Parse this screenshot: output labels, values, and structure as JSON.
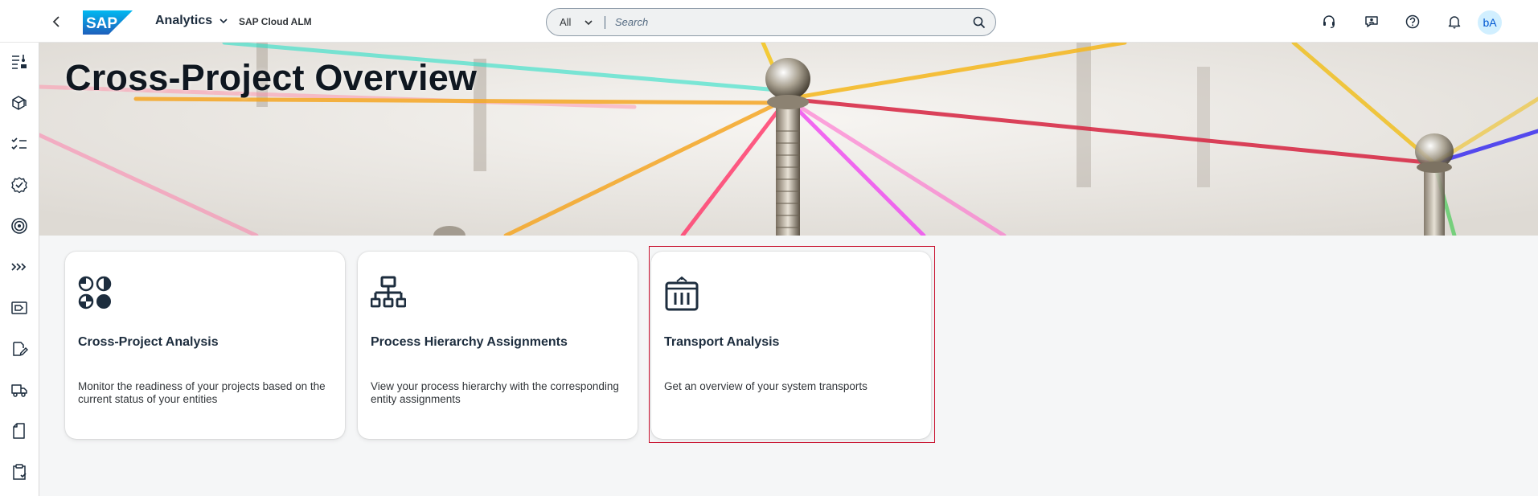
{
  "shell": {
    "app_title": "Analytics",
    "product_name": "SAP Cloud ALM",
    "search_scope": "All",
    "search_placeholder": "Search",
    "avatar_initials": "bA",
    "logo_text": "SAP"
  },
  "page": {
    "title": "Cross-Project Overview"
  },
  "sidenav": {
    "items": [
      {
        "icon": "overview-settings-icon"
      },
      {
        "icon": "cubes-icon"
      },
      {
        "icon": "task-list-icon"
      },
      {
        "icon": "approval-check-icon"
      },
      {
        "icon": "target-icon"
      },
      {
        "icon": "process-chevrons-icon"
      },
      {
        "icon": "label-tag-icon"
      },
      {
        "icon": "edit-document-icon"
      },
      {
        "icon": "truck-icon"
      },
      {
        "icon": "document-icon"
      },
      {
        "icon": "clipboard-check-icon"
      }
    ]
  },
  "cards": [
    {
      "title": "Cross-Project Analysis",
      "description": "Monitor the readiness of your projects based on the current status of your entities",
      "icon": "pie-chart-grid-icon"
    },
    {
      "title": "Process Hierarchy Assignments",
      "description": "View your process hierarchy with the corresponding entity assignments",
      "icon": "org-hierarchy-icon"
    },
    {
      "title": "Transport Analysis",
      "description": "Get an overview of your system transports",
      "icon": "transport-container-icon"
    }
  ],
  "colors": {
    "accent": "#0070f2",
    "highlight_border": "#c8102e",
    "text_primary": "#1d2d3e",
    "avatar_bg": "#d1efff"
  }
}
